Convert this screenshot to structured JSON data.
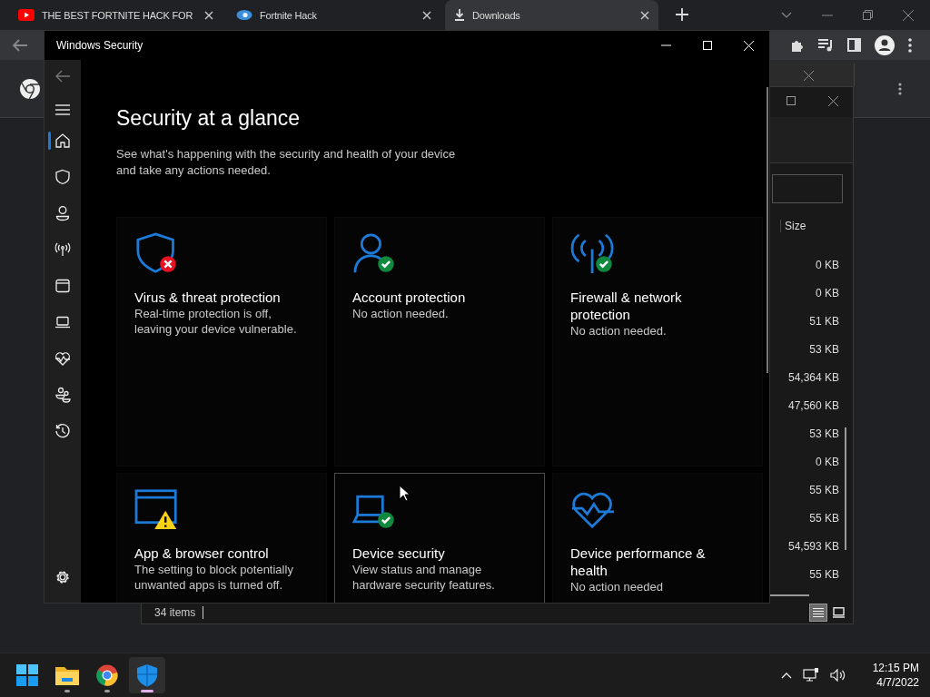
{
  "browser": {
    "tabs": [
      {
        "kind": "video",
        "title": "THE BEST FORTNITE HACK FOR",
        "selected": false
      },
      {
        "kind": "web",
        "title": "Fortnite Hack",
        "selected": false
      },
      {
        "kind": "download",
        "title": "Downloads",
        "selected": true
      }
    ]
  },
  "file_explorer": {
    "column_header": "Size",
    "sizes": [
      "0 KB",
      "0 KB",
      "51 KB",
      "53 KB",
      "54,364 KB",
      "47,560 KB",
      "53 KB",
      "0 KB",
      "55 KB",
      "55 KB",
      "54,593 KB",
      "55 KB"
    ],
    "status": "34 items",
    "views": [
      {
        "kind": "details",
        "selected": true
      },
      {
        "kind": "tiles",
        "selected": false
      }
    ]
  },
  "security": {
    "title": "Windows Security",
    "heading": "Security at a glance",
    "subtitle": "See what's happening with the security and health of your device and take any actions needed.",
    "nav": [
      {
        "kind": "home",
        "selected": true
      },
      {
        "kind": "shield",
        "selected": false
      },
      {
        "kind": "person",
        "selected": false
      },
      {
        "kind": "antenna",
        "selected": false
      },
      {
        "kind": "window",
        "selected": false
      },
      {
        "kind": "laptop",
        "selected": false
      },
      {
        "kind": "heart",
        "selected": false
      },
      {
        "kind": "family",
        "selected": false
      },
      {
        "kind": "history",
        "selected": false
      }
    ],
    "cards": [
      {
        "kind": "shield",
        "badge": {
          "kind": "error"
        },
        "title": "Virus & threat protection",
        "description": "Real-time protection is off, leaving your device vulnerable.",
        "hovered": false
      },
      {
        "kind": "person",
        "badge": {
          "kind": "ok"
        },
        "title": "Account protection",
        "description": "No action needed.",
        "hovered": false
      },
      {
        "kind": "antenna",
        "badge": {
          "kind": "ok"
        },
        "title": "Firewall & network protection",
        "description": "No action needed.",
        "hovered": false
      },
      {
        "kind": "window",
        "badge": {
          "kind": "warning"
        },
        "title": "App & browser control",
        "description": "The setting to block potentially unwanted apps is turned off.",
        "hovered": false
      },
      {
        "kind": "laptop",
        "badge": {
          "kind": "ok"
        },
        "title": "Device security",
        "description": "View status and manage hardware security features.",
        "hovered": true
      },
      {
        "kind": "heart",
        "title": "Device performance & health",
        "description": "No action needed",
        "hovered": false
      }
    ]
  },
  "taskbar": {
    "apps": [
      {
        "kind": "start",
        "running": false,
        "active": false
      },
      {
        "kind": "folder",
        "running": true,
        "active": false
      },
      {
        "kind": "chrome",
        "running": true,
        "active": false
      },
      {
        "kind": "security",
        "running": true,
        "active": true
      }
    ],
    "time": "12:15 PM",
    "date": "4/7/2022"
  }
}
